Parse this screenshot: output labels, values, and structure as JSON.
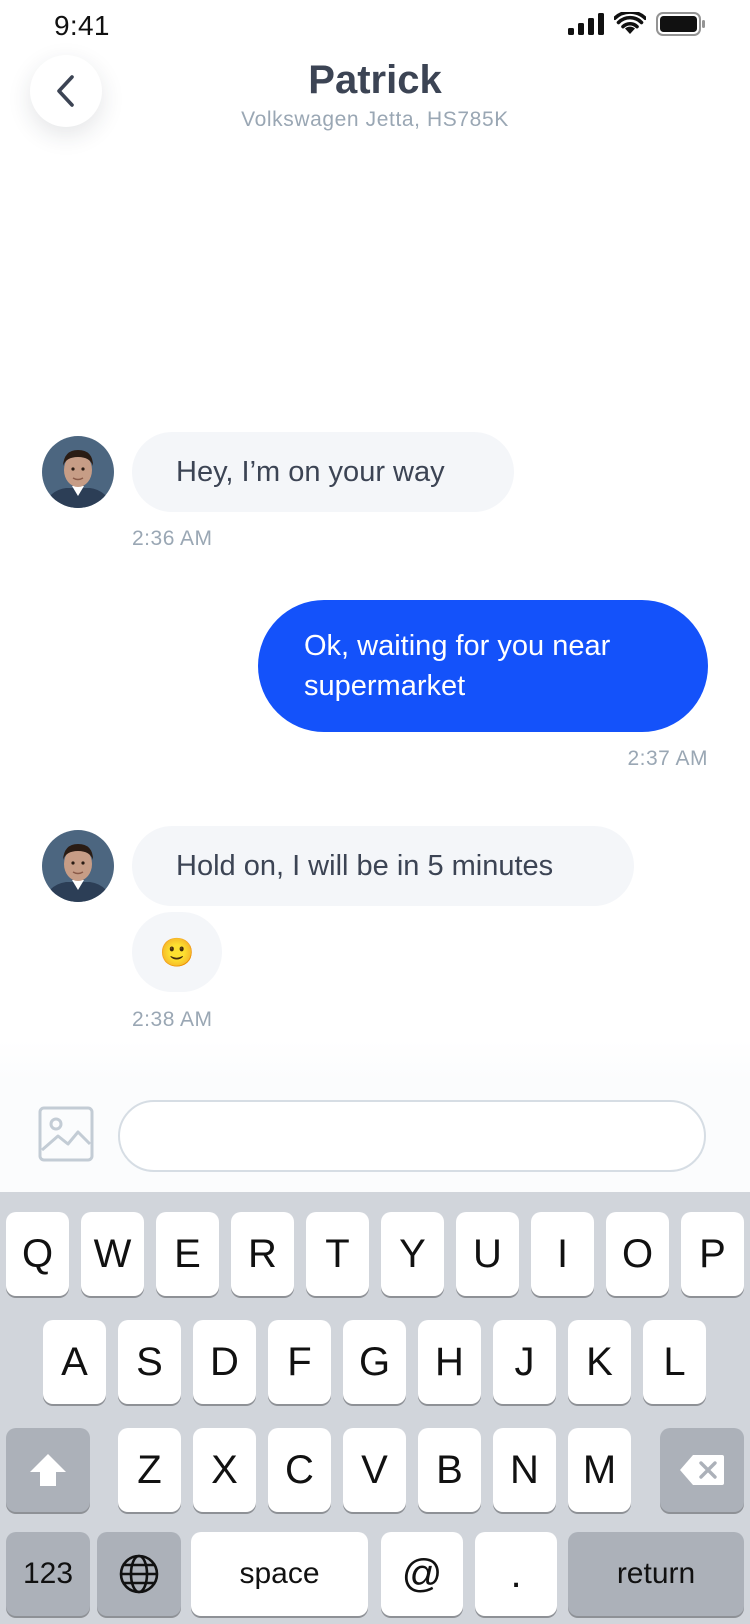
{
  "status_bar": {
    "time": "9:41",
    "icons": [
      "cellular-signal-icon",
      "wifi-icon",
      "battery-icon"
    ]
  },
  "header": {
    "back_icon": "chevron-left-icon",
    "name": "Patrick",
    "subtitle": "Volkswagen Jetta, HS785K"
  },
  "messages": [
    {
      "from": "driver",
      "text": "Hey, I’m on your way",
      "time": "2:36 AM"
    },
    {
      "from": "me",
      "text": "Ok, waiting for you near supermarket",
      "time": "2:37 AM"
    },
    {
      "from": "driver",
      "text": "Hold on, I will be in 5 minutes",
      "emoji": "🙂",
      "time": "2:38 AM"
    }
  ],
  "composer": {
    "image_icon": "image-icon",
    "placeholder": "",
    "value": ""
  },
  "keyboard": {
    "row1": [
      "Q",
      "W",
      "E",
      "R",
      "T",
      "Y",
      "U",
      "I",
      "O",
      "P"
    ],
    "row2": [
      "A",
      "S",
      "D",
      "F",
      "G",
      "H",
      "J",
      "K",
      "L"
    ],
    "row3": [
      "Z",
      "X",
      "C",
      "V",
      "B",
      "N",
      "M"
    ],
    "shift_icon": "shift-arrow-icon",
    "delete_icon": "backspace-icon",
    "numbers_label": "123",
    "globe_icon": "globe-icon",
    "space_label": "space",
    "at_label": "@",
    "dot_label": ".",
    "return_label": "return"
  },
  "colors": {
    "accent": "#1452fa",
    "bubble_in": "#f4f6f9",
    "text": "#3c4454",
    "muted": "#9aa7b4",
    "keyboard_bg": "#d1d5db"
  }
}
